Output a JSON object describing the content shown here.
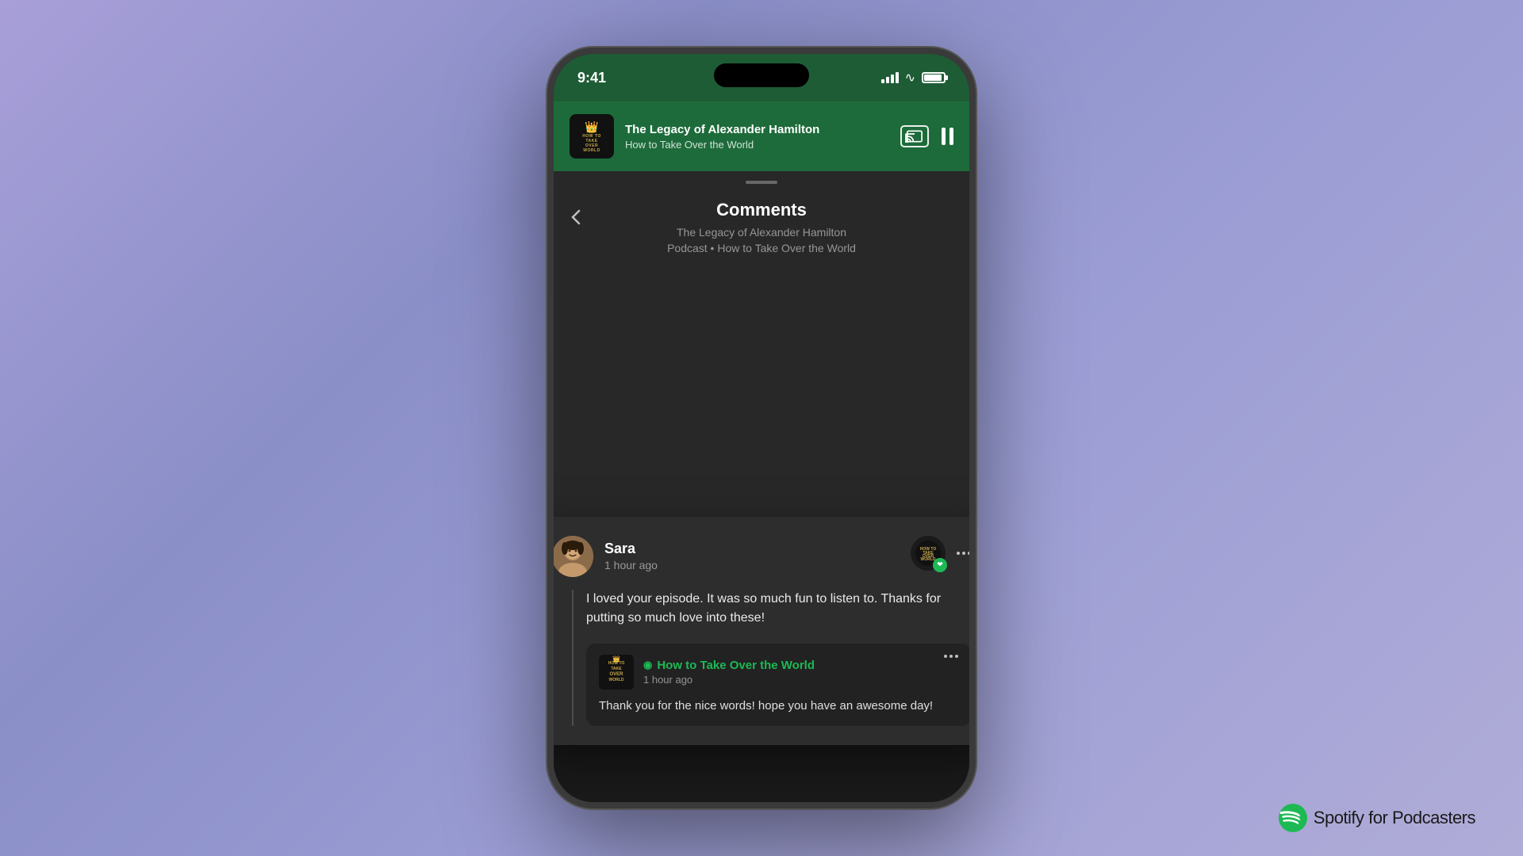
{
  "app": {
    "background": "linear-gradient(135deg, #a89fd8, #8b8fc8, #9b9dd4, #b0acd8)"
  },
  "statusBar": {
    "time": "9:41",
    "batteryLevel": "90%"
  },
  "nowPlaying": {
    "episodeTitle": "The Legacy of Alexander Hamilton",
    "podcastName": "How to Take Over the World",
    "albumArtLines": [
      "HOW TO",
      "TAKE",
      "OVER",
      "WORLD"
    ],
    "crownEmoji": "👑"
  },
  "commentsSection": {
    "title": "Comments",
    "subtitle": "The Legacy of Alexander Hamilton\nPodcast • How to Take Over the World",
    "backLabel": "‹"
  },
  "comment": {
    "userName": "Sara",
    "timeAgo": "1 hour ago",
    "text": "I loved your episode. It was so much fun to listen to. Thanks for putting so much love into these!",
    "likeIcon": "♥"
  },
  "reply": {
    "podcastName": "How to Take Over the World",
    "timeAgo": "1 hour ago",
    "text": "Thank you for the nice words! hope you have an awesome day!",
    "verifiedIcon": "⊙",
    "albumArtLines": [
      "HOW TO",
      "TAKE",
      "OVER",
      "WORLD"
    ]
  },
  "spotifyBranding": {
    "name": "Spotify",
    "suffix": " for Podcasters"
  },
  "icons": {
    "castIcon": "cast-icon",
    "pauseIcon": "pause-icon",
    "heartIcon": "❤",
    "dotsIcon": "•••",
    "chevronDown": "❮"
  }
}
